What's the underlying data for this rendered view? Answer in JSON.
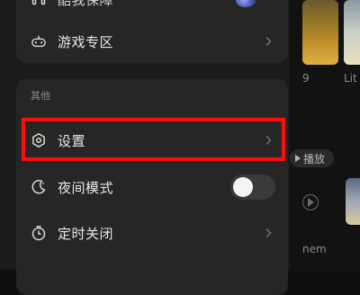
{
  "background": {
    "fragments": [
      "9",
      "Lit",
      "nem"
    ],
    "play_chip": "播放"
  },
  "drawer": {
    "partial_item": {
      "label": "酷我保障",
      "icon": "headset-icon"
    },
    "items_top": [
      {
        "id": "games",
        "label": "游戏专区",
        "icon": "gamepad-icon",
        "has_chevron": true
      }
    ],
    "section_other": {
      "title": "其他",
      "items": [
        {
          "id": "settings",
          "label": "设置",
          "icon": "hexagon-settings-icon",
          "has_chevron": true
        },
        {
          "id": "night-mode",
          "label": "夜间模式",
          "icon": "moon-icon",
          "toggle": {
            "on": false
          }
        },
        {
          "id": "timer-off",
          "label": "定时关闭",
          "icon": "timer-icon",
          "has_chevron": true
        }
      ]
    }
  },
  "colors": {
    "highlight": "#ff0d0d",
    "panel": "#262626",
    "drawer": "#1c1c1c"
  }
}
